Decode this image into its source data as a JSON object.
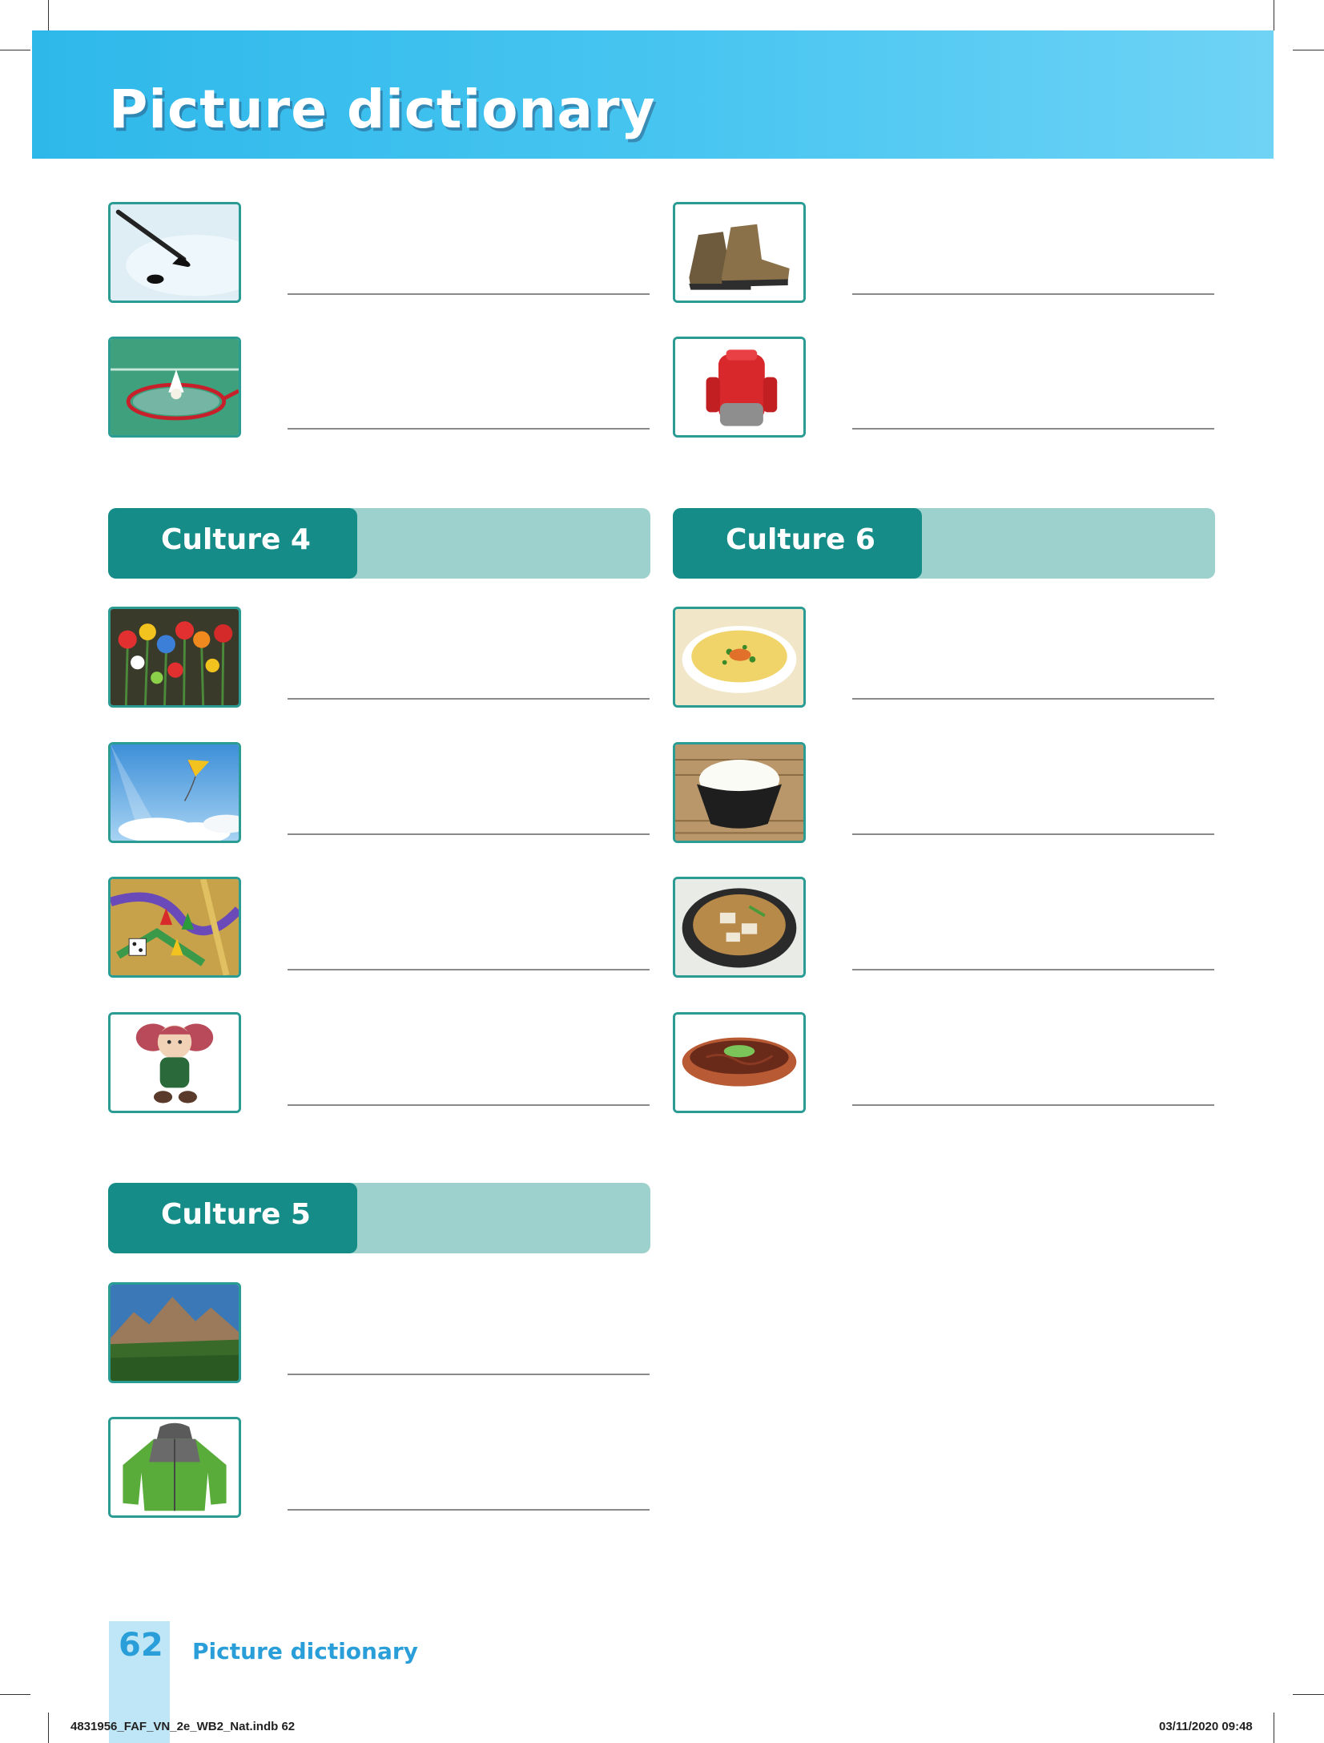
{
  "header": {
    "title": "Picture dictionary"
  },
  "sections": [
    {
      "label": "Culture 4"
    },
    {
      "label": "Culture 6"
    },
    {
      "label": "Culture 5"
    }
  ],
  "pictures": {
    "hockey": "ice-hockey-stick-and-puck",
    "badminton": "badminton-racket-and-shuttlecock",
    "boots": "hiking-boots",
    "backpack": "red-backpack",
    "flowers": "colourful-flower-figurines",
    "kite": "kite-in-sky",
    "board_game": "board-game-with-dice",
    "doll": "rag-doll",
    "soup": "corn-soup",
    "rice": "bowl-of-rice",
    "stew": "tofu-stew-in-pot",
    "beef": "stir-fried-beef-dish",
    "mountains": "mountain-landscape",
    "jacket": "green-winter-jacket"
  },
  "footer": {
    "page_number": "62",
    "title": "Picture dictionary",
    "slug_left": "4831956_FAF_VN_2e_WB2_Nat.indb   62",
    "slug_right": "03/11/2020   09:48"
  }
}
